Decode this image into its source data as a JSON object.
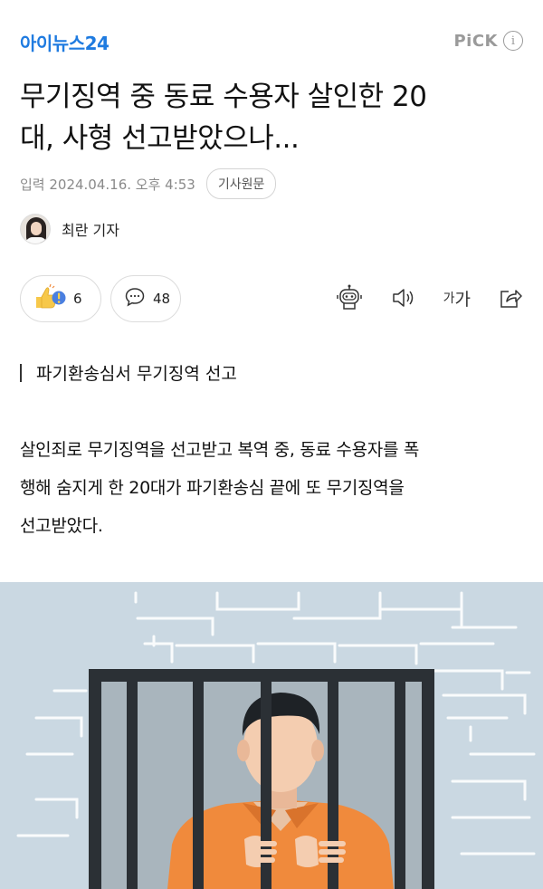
{
  "header": {
    "logo": "아이뉴스24",
    "pick_label": "PiCK",
    "info_glyph": "i"
  },
  "article": {
    "title_line1": "무기징역 중 동료 수용자 살인한 20",
    "title_line2": "대, 사형 선고받았으나...",
    "meta": {
      "date": "입력 2024.04.16. 오후 4:53",
      "original_button": "기사원문"
    },
    "author": {
      "name": "최란 기자"
    },
    "reactions": {
      "like_count": "6",
      "comment_count": "48"
    },
    "toolbar": {
      "font_small": "가",
      "font_large": "가"
    },
    "subheading": "파기환송심서 무기징역 선고",
    "body_lines": [
      "살인죄로 무기징역을 선고받고 복역 중, 동료 수용자를 폭",
      "행해 숨지게 한 20대가 파기환송심 끝에 또 무기징역을",
      "선고받았다."
    ]
  },
  "icons": [
    "like-reaction-icon",
    "comment-icon",
    "ai-bot-icon",
    "speaker-icon",
    "font-size-icon",
    "share-icon",
    "avatar-icon"
  ],
  "colors": {
    "logo": "#1f7be0",
    "illustration_bg": "#cad8e2",
    "prisoner_shirt": "#f08a3c",
    "bars": "#2b3035"
  }
}
